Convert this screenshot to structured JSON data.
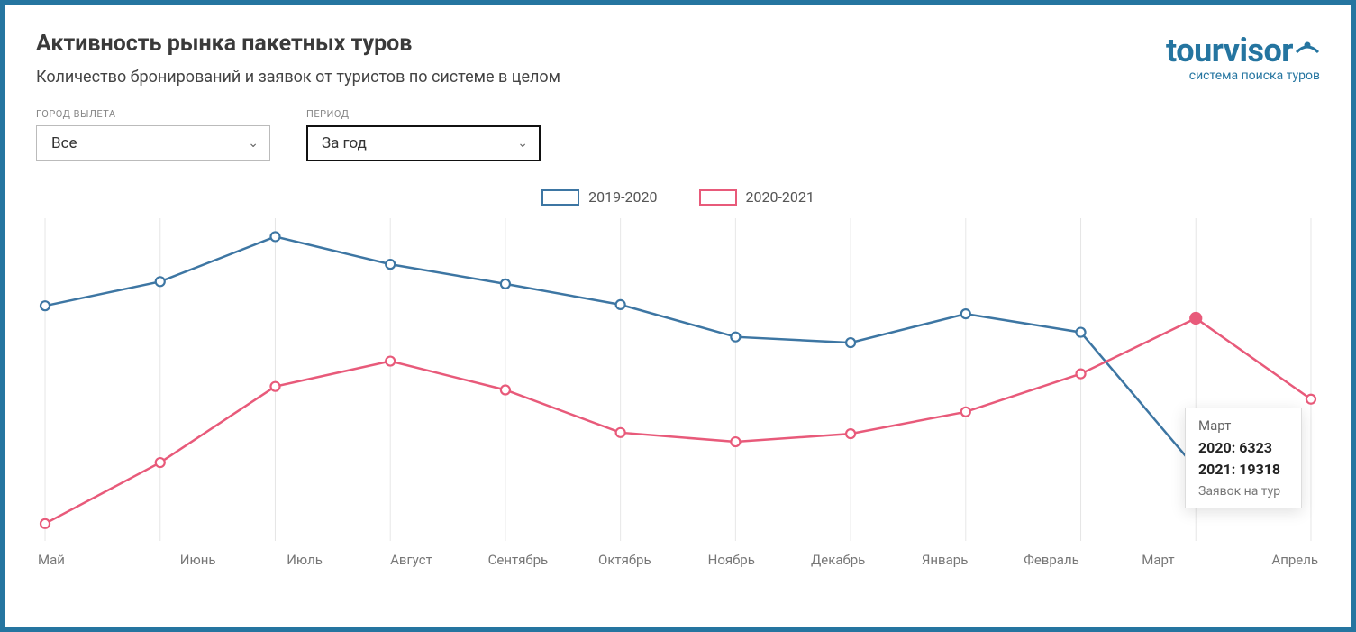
{
  "title": "Активность рынка пакетных туров",
  "subtitle": "Количество бронирований и заявок от туристов по системе в целом",
  "logo": {
    "name": "tourvisor",
    "tagline": "система поиска туров"
  },
  "filters": {
    "city": {
      "label": "ГОРОД ВЫЛЕТА",
      "value": "Все"
    },
    "period": {
      "label": "ПЕРИОД",
      "value": "За год"
    }
  },
  "legend": {
    "s1": "2019-2020",
    "s2": "2020-2021"
  },
  "colors": {
    "s1": "#3d76a3",
    "s2": "#e85a7a",
    "grid": "#e6e6e6"
  },
  "tooltip": {
    "head": "Март",
    "row1_label": "2020",
    "row1_value": "6323",
    "row2_label": "2021",
    "row2_value": "19318",
    "foot": "Заявок на тур"
  },
  "chart_data": {
    "type": "line",
    "title": "Активность рынка пакетных туров",
    "xlabel": "",
    "ylabel": "",
    "categories": [
      "Май",
      "Июнь",
      "Июль",
      "Август",
      "Сентябрь",
      "Октябрь",
      "Ноябрь",
      "Декабрь",
      "Январь",
      "Февраль",
      "Март",
      "Апрель"
    ],
    "series": [
      {
        "name": "2019-2020",
        "values": [
          20400,
          22500,
          26400,
          24000,
          22300,
          20500,
          17700,
          17200,
          19700,
          18100,
          6323,
          null
        ]
      },
      {
        "name": "2020-2021",
        "values": [
          1500,
          6800,
          13400,
          15600,
          13100,
          9400,
          8600,
          9300,
          11200,
          14500,
          19318,
          12300
        ]
      }
    ],
    "ylim": [
      0,
      28000
    ],
    "highlight_index": 10,
    "grid": true,
    "legend_position": "top"
  }
}
